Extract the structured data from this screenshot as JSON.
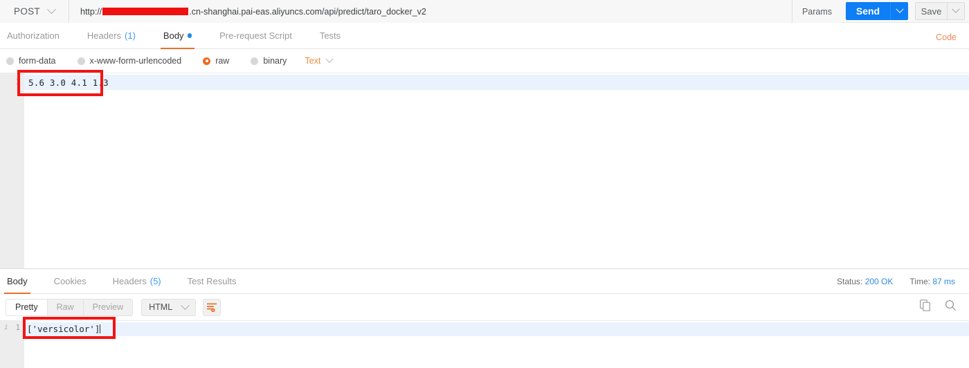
{
  "urlbar": {
    "method": "POST",
    "url_prefix": "http://",
    "url_redacted_placeholder": "",
    "url_suffix": ".cn-shanghai.pai-eas.aliyuncs.com/api/predict/taro_docker_v2",
    "params_label": "Params",
    "send_label": "Send",
    "save_label": "Save"
  },
  "request_tabs": [
    {
      "label": "Authorization",
      "count": "",
      "active": false,
      "dot": false
    },
    {
      "label": "Headers",
      "count": "(1)",
      "active": false,
      "dot": false
    },
    {
      "label": "Body",
      "count": "",
      "active": true,
      "dot": true
    },
    {
      "label": "Pre-request Script",
      "count": "",
      "active": false,
      "dot": false
    },
    {
      "label": "Tests",
      "count": "",
      "active": false,
      "dot": false
    }
  ],
  "code_link": "Code",
  "body_types": [
    {
      "label": "form-data",
      "selected": false
    },
    {
      "label": "x-www-form-urlencoded",
      "selected": false
    },
    {
      "label": "raw",
      "selected": true
    },
    {
      "label": "binary",
      "selected": false
    }
  ],
  "raw_format": "Text",
  "request_body": {
    "line_number": "1",
    "content": "5.6 3.0 4.1 1.3"
  },
  "response_tabs": [
    {
      "label": "Body",
      "count": "",
      "active": true
    },
    {
      "label": "Cookies",
      "count": "",
      "active": false
    },
    {
      "label": "Headers",
      "count": "(5)",
      "active": false
    },
    {
      "label": "Test Results",
      "count": "",
      "active": false
    }
  ],
  "response_meta": {
    "status_label": "Status:",
    "status_value": "200 OK",
    "time_label": "Time:",
    "time_value": "87 ms"
  },
  "response_toolbar": {
    "views": [
      {
        "label": "Pretty",
        "active": true
      },
      {
        "label": "Raw",
        "active": false
      },
      {
        "label": "Preview",
        "active": false
      }
    ],
    "format": "HTML"
  },
  "response_body": {
    "fold_marker": "i",
    "line_number": "1",
    "content": "['versicolor']"
  },
  "colors": {
    "accent_orange": "#e8702a",
    "send_blue": "#0d7ef5",
    "link_blue": "#2f8ae0",
    "annotation_red": "#f31414",
    "radio_on": "#ed6c1f"
  }
}
